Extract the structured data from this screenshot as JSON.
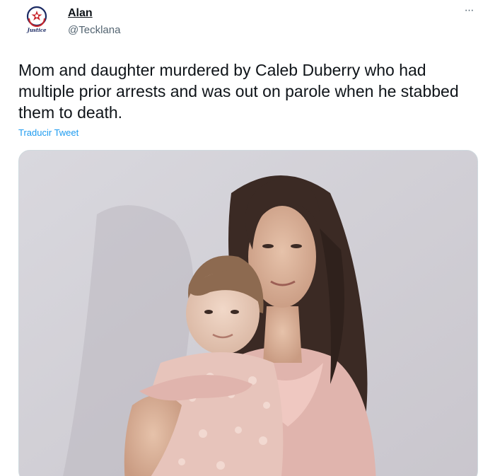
{
  "author": {
    "name": "Alan",
    "handle": "@Tecklana",
    "avatar_icon": "justice-badge-icon",
    "avatar_label": "Justice"
  },
  "more_icon": "more-options-icon",
  "more_glyph": "···",
  "tweet": {
    "text": "Mom and daughter murdered by Caleb Duberry who had multiple prior arrests and was out on parole when he stabbed them to death.",
    "translate_label": "Traducir Tweet"
  },
  "media": {
    "description_icon": "photo-mother-daughter"
  },
  "colors": {
    "link": "#1d9bf0",
    "secondary_text": "#536471",
    "primary_text": "#0f1419"
  }
}
